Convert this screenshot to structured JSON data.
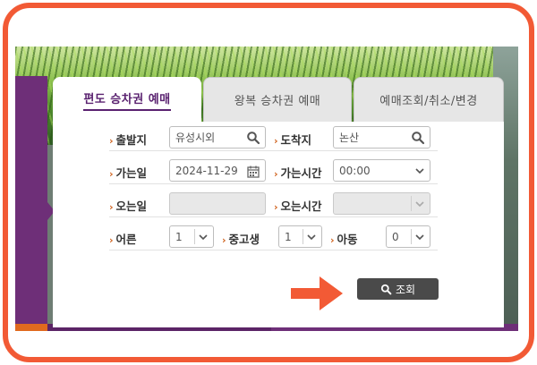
{
  "tabs": [
    {
      "label": "편도 승차권 예매",
      "active": true
    },
    {
      "label": "왕복 승차권 예매",
      "active": false
    },
    {
      "label": "예매조회/취소/변경",
      "active": false
    }
  ],
  "form": {
    "departure": {
      "label": "출발지",
      "value": "유성시외"
    },
    "arrival": {
      "label": "도착지",
      "value": "논산"
    },
    "go_date": {
      "label": "가는일",
      "value": "2024-11-29"
    },
    "go_time": {
      "label": "가는시간",
      "value": "00:00"
    },
    "return_date": {
      "label": "오는일",
      "value": ""
    },
    "return_time": {
      "label": "오는시간",
      "value": ""
    },
    "adult": {
      "label": "어른",
      "value": "1"
    },
    "youth": {
      "label": "중고생",
      "value": "1"
    },
    "child": {
      "label": "아동",
      "value": "0"
    }
  },
  "search_button": {
    "label": "조회"
  },
  "colors": {
    "frame": "#f25a35",
    "brand_purple": "#6e2f78",
    "label_arrow": "#d0611c",
    "button_bg": "#4a4a4a"
  },
  "icons": [
    "search-icon",
    "calendar-icon",
    "chevron-down-icon",
    "arrow-right-icon"
  ]
}
